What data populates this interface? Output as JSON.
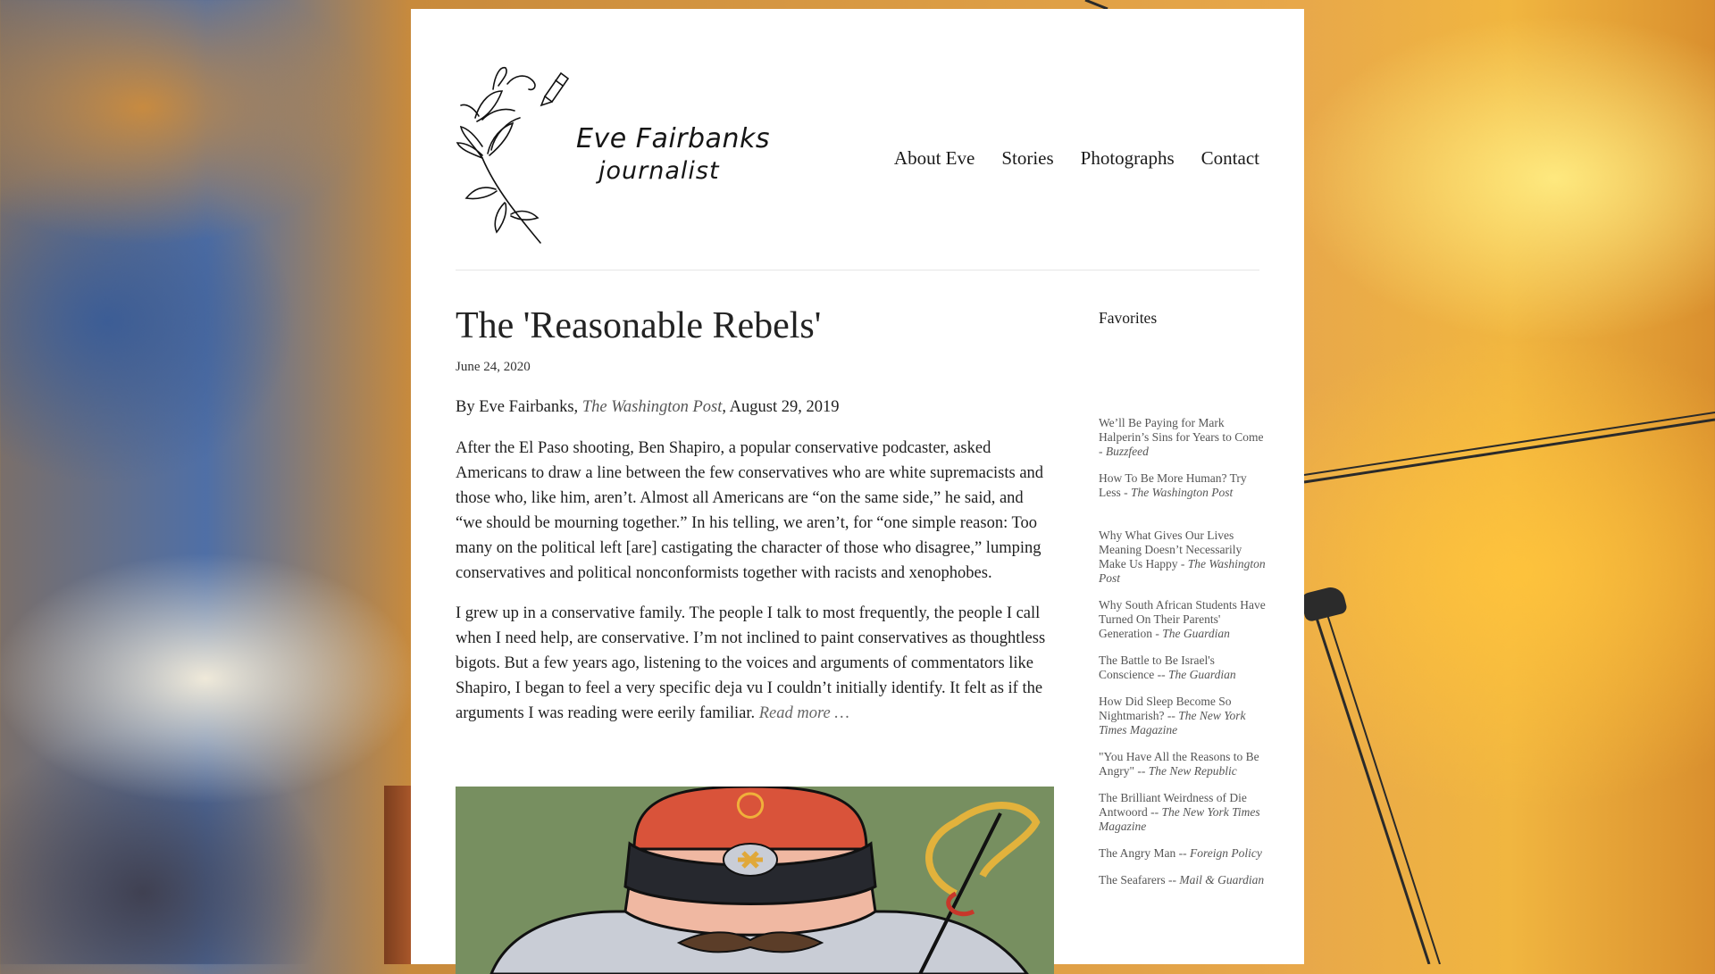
{
  "site": {
    "logo_name": "Eve Fairbanks",
    "logo_role": "journalist"
  },
  "nav": {
    "items": [
      {
        "label": "About Eve"
      },
      {
        "label": "Stories"
      },
      {
        "label": "Photographs"
      },
      {
        "label": "Contact"
      }
    ]
  },
  "post": {
    "title": "The 'Reasonable Rebels'",
    "date": "June 24, 2020",
    "byline_prefix": "By Eve Fairbanks, ",
    "byline_publication": "The Washington Post",
    "byline_suffix": ", August 29, 2019",
    "paragraph1": "After the El Paso shooting, Ben Shapiro, a popular conservative podcaster, asked Americans to draw a line between the few conservatives who are white supremacists and those who, like him, aren’t. Almost all Americans are “on the same side,” he said, and “we should be mourning together.” In his telling, we aren’t, for “one simple reason: Too many on the political left [are] castigating the character of those who disagree,” lumping conservatives and political nonconformists together with racists and xenophobes.",
    "paragraph2": "I grew up in a conservative family. The people I talk to most frequently, the people I call when I need help, are conservative. I’m not inclined to paint conservatives as thoughtless bigots. But a few years ago, listening to the voices and arguments of commentators like Shapiro, I began to feel a very specific deja vu I couldn’t initially identify. It felt as if the arguments I was reading were eerily familiar.",
    "read_more": "Read more …"
  },
  "sidebar": {
    "heading": "Favorites",
    "items": [
      {
        "title": "We’ll Be Paying for Mark Halperin’s Sins for Years to Come - ",
        "source": "Buzzfeed"
      },
      {
        "title": "How To Be More Human? Try Less - ",
        "source": "The Washington Post"
      },
      {
        "title": "Why What Gives Our Lives Meaning Doesn’t Necessarily Make Us Happy - ",
        "source": "The Washington Post"
      },
      {
        "title": "Why South African Students Have Turned On Their Parents' Generation - ",
        "source": "The Guardian"
      },
      {
        "title": "The Battle to Be Israel's Conscience -- ",
        "source": "The Guardian"
      },
      {
        "title": "How Did Sleep Become So Nightmarish? -- ",
        "source": "The New York Times Magazine"
      },
      {
        "title": "\"You Have All the Reasons to Be Angry\" -- ",
        "source": "The New Republic"
      },
      {
        "title": "The Brilliant Weirdness of Die Antwoord -- ",
        "source": "The New York Times Magazine"
      },
      {
        "title": "The Angry Man -- ",
        "source": "Foreign Policy"
      },
      {
        "title": "The Seafarers -- ",
        "source": "Mail & Guardian"
      }
    ]
  },
  "colors": {
    "text": "#1f1f1f",
    "muted": "#555555",
    "card": "#ffffff",
    "illustration_bg": "#778f60",
    "cap_red": "#d9533a"
  }
}
